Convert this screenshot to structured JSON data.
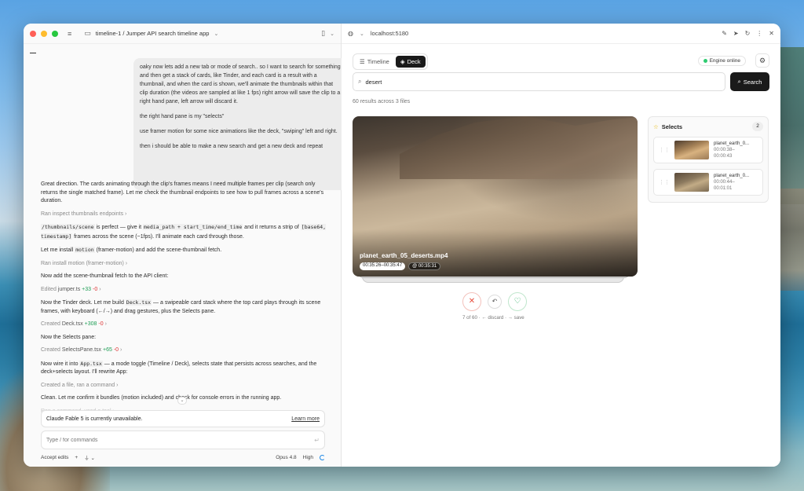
{
  "window": {
    "title": "timeline-1 / Jumper API search timeline app"
  },
  "chat": {
    "user_message": [
      "oaky now lets add a new tab or mode of search.. so I want to search for something and then get a stack of cards, like Tinder, and each card is a result with a thumbnail, and when the card is shown, we'll animate the thumbnails within that clip duration (the videos are sampled at like 1 fps) right arrow will save the clip to a right hand pane, left arrow will discard it.",
      "the right hand pane is my \"selects\"",
      "use framer motion for some nice animations like the deck, \"swiping\" left and right.",
      "then i should be able to make a new search and get a new deck and repeat"
    ],
    "assistant_1": "Great direction. The cards animating through the clip's frames means I need multiple frames per clip (search only returns the single matched frame). Let me check the thumbnail endpoints to see how to pull frames across a scene's duration.",
    "tool_1": "Ran inspect thumbnails endpoints",
    "assistant_2_a": "/thumbnails/scene",
    "assistant_2_b": " is perfect — give it ",
    "assistant_2_c": "media_path + start_time/end_time",
    "assistant_2_d": " and it returns a strip of ",
    "assistant_2_e": "[base64, timestamp]",
    "assistant_2_f": " frames across the scene (~1fps). I'll animate each card through those.",
    "assistant_3_a": "Let me install ",
    "assistant_3_b": "motion",
    "assistant_3_c": " (framer-motion) and add the scene-thumbnail fetch.",
    "tool_2": "Ran install motion (framer-motion)",
    "assistant_4": "Now add the scene-thumbnail fetch to the API client:",
    "edit_1_label": "Edited",
    "edit_1_file": "jumper.ts",
    "edit_1_plus": "+33",
    "edit_1_minus": "-0",
    "assistant_5_a": "Now the Tinder deck. Let me build ",
    "assistant_5_b": "Deck.tsx",
    "assistant_5_c": " — a swipeable card stack where the top card plays through its scene frames, with keyboard (←/→) and drag gestures, plus the Selects pane.",
    "create_1_label": "Created",
    "create_1_file": "Deck.tsx",
    "create_1_plus": "+308",
    "create_1_minus": "-0",
    "assistant_6": "Now the Selects pane:",
    "create_2_label": "Created",
    "create_2_file": "SelectsPane.tsx",
    "create_2_plus": "+65",
    "create_2_minus": "-0",
    "assistant_7_a": "Now wire it into ",
    "assistant_7_b": "App.tsx",
    "assistant_7_c": " — a mode toggle (Timeline / Deck), selects state that persists across searches, and the deck+selects layout. I'll rewrite App:",
    "tool_3": "Created a file, ran a command",
    "assistant_8": "Clean. Let me confirm it bundles (motion included) and check for console errors in the running app.",
    "tool_4": "Ran a command, used a tool",
    "notice": "Claude Fable 5 is currently unavailable.",
    "learn_more": "Learn more",
    "composer_placeholder": "Type / for commands",
    "accept_edits": "Accept edits",
    "model": "Opus 4.8",
    "effort": "High"
  },
  "browser": {
    "url": "localhost:5180"
  },
  "app": {
    "tabs": [
      {
        "label": "Timeline"
      },
      {
        "label": "Deck"
      }
    ],
    "engine_status": "Engine online",
    "search_value": "desert",
    "search_button": "Search",
    "result_count": "60 results across 3 files",
    "card": {
      "filename": "planet_earth_05_deserts.mp4",
      "range": "00:35:26–00:35:47",
      "timestamp": "@ 00:35:31"
    },
    "progress_hint": "7 of 60 · ← discard · → save",
    "selects": {
      "title": "Selects",
      "count": "2",
      "items": [
        {
          "name": "planet_earth_0...",
          "start": "00:00:38–",
          "end": "00:00:43"
        },
        {
          "name": "planet_earth_0...",
          "start": "00:00:44–",
          "end": "00:01:01"
        }
      ]
    }
  },
  "colors": {
    "accent": "#1a1a1a",
    "discard": "#e74c3c",
    "save": "#27ae60",
    "online": "#2ecc71"
  }
}
